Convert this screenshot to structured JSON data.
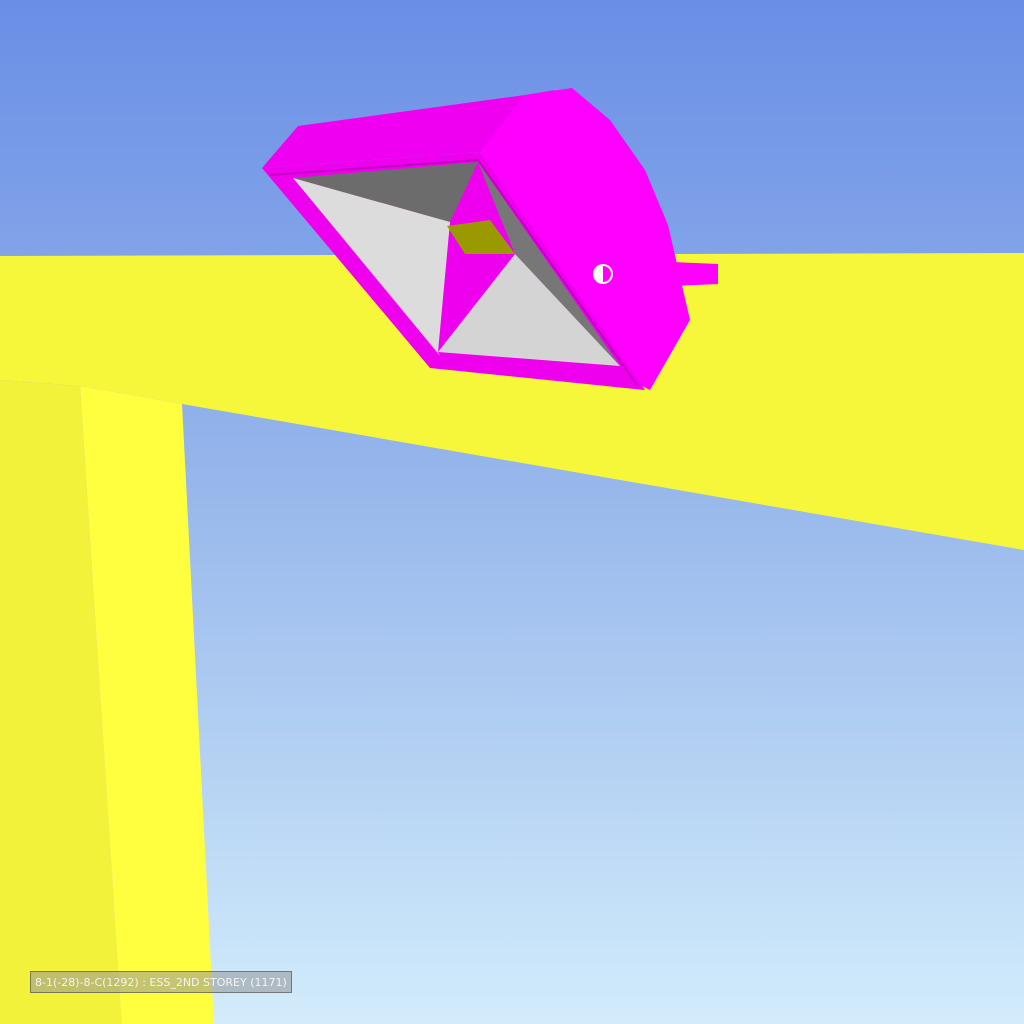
{
  "viewer": {
    "status_label": "8-1(-28)-8-C(1292) : ESS_2ND STOREY (1171)"
  },
  "colors": {
    "sky_top": "#6a8ee6",
    "sky_bottom": "#d2ecfc",
    "beam": "#f6f73a",
    "column": "#ffff40",
    "fixture_body": "#ff00ff",
    "reflector_light": "#dcdcdc",
    "reflector_dark": "#6c6c6c",
    "led_chip": "#9a9a00"
  }
}
